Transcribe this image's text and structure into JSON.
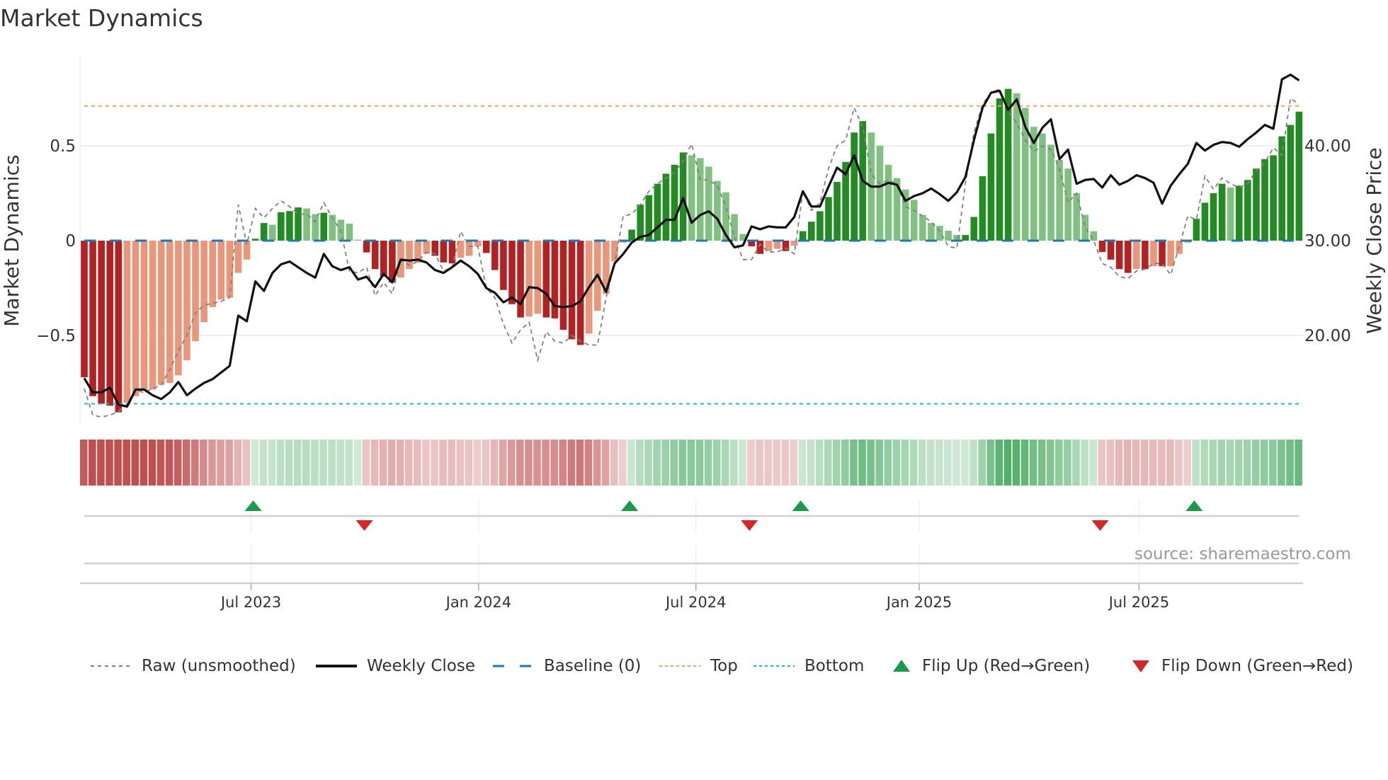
{
  "chart_data": {
    "type": "bar",
    "title": "Market Dynamics",
    "ylabel": "Market Dynamics",
    "y2label": "Weekly Close Price",
    "ylim": [
      -0.98,
      0.95
    ],
    "y2lim": [
      15.6,
      44.4
    ],
    "yticks": [
      {
        "v": 0.5,
        "label": "0.5"
      },
      {
        "v": 0,
        "label": "0"
      },
      {
        "v": -0.5,
        "label": "−0.5"
      }
    ],
    "y2ticks": [
      {
        "v": 40,
        "label": "40.00"
      },
      {
        "v": 30,
        "label": "30.00"
      },
      {
        "v": 20,
        "label": "20.00"
      }
    ],
    "xticks": [
      {
        "week": 19.5,
        "label": "Jul 2023"
      },
      {
        "week": 46.1,
        "label": "Jan 2024"
      },
      {
        "week": 71.5,
        "label": "Jul 2024"
      },
      {
        "week": 97.6,
        "label": "Jan 2025"
      },
      {
        "week": 123.3,
        "label": "Jul 2025"
      }
    ],
    "top_level": 0.71,
    "bottom_level": -0.86,
    "baseline": 0,
    "dynamics": [
      -0.72,
      -0.82,
      -0.86,
      -0.87,
      -0.905,
      -0.855,
      -0.82,
      -0.79,
      -0.785,
      -0.76,
      -0.75,
      -0.71,
      -0.63,
      -0.53,
      -0.43,
      -0.35,
      -0.31,
      -0.3,
      -0.17,
      -0.1,
      0.01,
      0.093,
      0.084,
      0.15,
      0.156,
      0.175,
      0.17,
      0.14,
      0.147,
      0.136,
      0.11,
      0.09,
      0.005,
      -0.062,
      -0.15,
      -0.19,
      -0.22,
      -0.195,
      -0.15,
      -0.117,
      -0.07,
      -0.08,
      -0.115,
      -0.12,
      -0.09,
      -0.08,
      -0.03,
      -0.065,
      -0.155,
      -0.26,
      -0.335,
      -0.405,
      -0.4,
      -0.385,
      -0.405,
      -0.41,
      -0.47,
      -0.52,
      -0.55,
      -0.49,
      -0.37,
      -0.28,
      -0.11,
      -0.01,
      0.058,
      0.19,
      0.24,
      0.3,
      0.353,
      0.4,
      0.465,
      0.45,
      0.435,
      0.39,
      0.315,
      0.255,
      0.14,
      0.035,
      -0.03,
      -0.07,
      -0.055,
      -0.043,
      -0.055,
      -0.026,
      0.05,
      0.1,
      0.155,
      0.23,
      0.31,
      0.415,
      0.57,
      0.63,
      0.57,
      0.5,
      0.4,
      0.33,
      0.27,
      0.215,
      0.135,
      0.093,
      0.078,
      0.052,
      0.03,
      0.03,
      0.125,
      0.34,
      0.565,
      0.75,
      0.8,
      0.777,
      0.7,
      0.6,
      0.565,
      0.506,
      0.426,
      0.38,
      0.25,
      0.136,
      0.05,
      -0.06,
      -0.1,
      -0.15,
      -0.17,
      -0.15,
      -0.15,
      -0.135,
      -0.135,
      -0.135,
      -0.07,
      -0.01,
      0.115,
      0.2,
      0.25,
      0.3,
      0.28,
      0.29,
      0.32,
      0.38,
      0.43,
      0.45,
      0.55,
      0.61,
      0.68
    ],
    "shade": "DDDDDLLLLLLLLLLLLLLLDDLDDDLLDLLLLDDDDLLLLDDDLLLDDDDDLLDDDDDLLLLLDDDDDDDLLLLLLLDDLLDLDDDDDDDDLLLLLLLLLLLDDDDDDLLLLLLLLLLDDDDLDLDLLLDDDDLDDDDDDDD",
    "raw": [
      -0.78,
      -0.92,
      -0.93,
      -0.92,
      -0.9,
      -0.86,
      -0.79,
      -0.8,
      -0.78,
      -0.76,
      -0.68,
      -0.58,
      -0.5,
      -0.38,
      -0.34,
      -0.33,
      -0.32,
      -0.3,
      0.19,
      -0.02,
      0.17,
      0.12,
      0.17,
      0.21,
      0.18,
      0.14,
      0.14,
      0.1,
      0.2,
      0.12,
      0.05,
      -0.16,
      -0.17,
      -0.14,
      -0.29,
      -0.22,
      -0.28,
      -0.1,
      -0.13,
      -0.11,
      -0.06,
      -0.07,
      -0.16,
      -0.14,
      0.05,
      -0.03,
      -0.03,
      -0.25,
      -0.3,
      -0.44,
      -0.54,
      -0.47,
      -0.43,
      -0.63,
      -0.48,
      -0.53,
      -0.54,
      -0.5,
      -0.53,
      -0.55,
      -0.55,
      -0.3,
      -0.12,
      0.13,
      0.14,
      0.19,
      0.26,
      0.3,
      0.33,
      0.36,
      0.42,
      0.51,
      0.32,
      0.32,
      0.29,
      0.18,
      0.02,
      -0.1,
      -0.1,
      -0.02,
      -0.06,
      -0.06,
      -0.04,
      -0.07,
      0.26,
      0.16,
      0.2,
      0.38,
      0.5,
      0.53,
      0.7,
      0.6,
      0.35,
      0.3,
      0.32,
      0.3,
      0.18,
      0.16,
      0.13,
      0.1,
      0.05,
      -0.03,
      -0.04,
      0.3,
      0.57,
      0.72,
      0.78,
      0.8,
      0.68,
      0.62,
      0.53,
      0.47,
      0.5,
      0.48,
      0.38,
      0.2,
      0.25,
      0.07,
      0.0,
      -0.12,
      -0.14,
      -0.19,
      -0.2,
      -0.16,
      -0.15,
      -0.12,
      -0.12,
      -0.18,
      -0.03,
      0.13,
      0.11,
      0.34,
      0.27,
      0.33,
      0.3,
      0.28,
      0.3,
      0.37,
      0.41,
      0.49,
      0.45,
      0.75,
      0.72
    ],
    "weekly_close": [
      15.5,
      14.0,
      14.0,
      14.5,
      12.7,
      12.5,
      14.3,
      14.3,
      13.7,
      13.3,
      14.0,
      15.1,
      13.7,
      14.4,
      15.0,
      15.4,
      16.1,
      16.8,
      22.1,
      21.5,
      25.7,
      24.7,
      26.6,
      27.5,
      27.8,
      27.2,
      26.6,
      26.1,
      28.6,
      27.3,
      26.9,
      27.2,
      25.9,
      26.2,
      25.1,
      26.5,
      25.6,
      28.0,
      27.9,
      28.0,
      27.7,
      26.9,
      26.6,
      27.2,
      27.9,
      27.3,
      26.5,
      25.0,
      24.5,
      23.5,
      24.0,
      23.3,
      25.1,
      25.0,
      24.4,
      23.1,
      23.0,
      23.1,
      23.6,
      25.1,
      26.4,
      24.6,
      27.6,
      28.6,
      29.8,
      30.4,
      30.6,
      31.4,
      32.2,
      32.2,
      34.5,
      31.9,
      32.7,
      33.1,
      32.3,
      30.6,
      29.3,
      29.5,
      31.5,
      31.2,
      31.5,
      31.4,
      31.4,
      32.5,
      35.2,
      33.6,
      33.6,
      35.7,
      37.7,
      37.0,
      39.0,
      36.3,
      35.7,
      35.7,
      36.1,
      35.9,
      34.2,
      34.7,
      35.0,
      35.5,
      34.9,
      34.2,
      35.1,
      36.7,
      40.6,
      44.0,
      45.6,
      45.8,
      43.8,
      44.9,
      42.0,
      40.3,
      41.9,
      42.8,
      38.6,
      39.6,
      36.0,
      36.4,
      36.5,
      35.6,
      36.9,
      35.9,
      36.3,
      36.9,
      36.6,
      36.1,
      33.9,
      35.8,
      37.0,
      38.1,
      40.3,
      39.5,
      40.1,
      40.4,
      40.3,
      39.9,
      40.7,
      41.4,
      42.2,
      41.8,
      47.0,
      47.5,
      46.9
    ],
    "flip_up_weeks": [
      20,
      64,
      84,
      130
    ],
    "flip_down_weeks": [
      33,
      78,
      119
    ],
    "legend": {
      "raw": "Raw (unsmoothed)",
      "close": "Weekly Close",
      "baseline": "Baseline (0)",
      "top": "Top",
      "bottom": "Bottom",
      "flip_up": "Flip Up (Red→Green)",
      "flip_down": "Flip Down (Green→Red)"
    },
    "legend_placement": "bottom"
  },
  "colors": {
    "dark_red": "#b22222",
    "light_red": "#e9967a",
    "dark_green": "#228b22",
    "light_green": "#80c080",
    "top": "#f4a460",
    "bottom": "#17becf",
    "baseline": "#1f77b4",
    "raw": "#808080",
    "close": "#111111",
    "flip_up": "#1a9a4a",
    "flip_down": "#d62728"
  },
  "title": "Market Dynamics",
  "source": "source: sharemaestro.com"
}
